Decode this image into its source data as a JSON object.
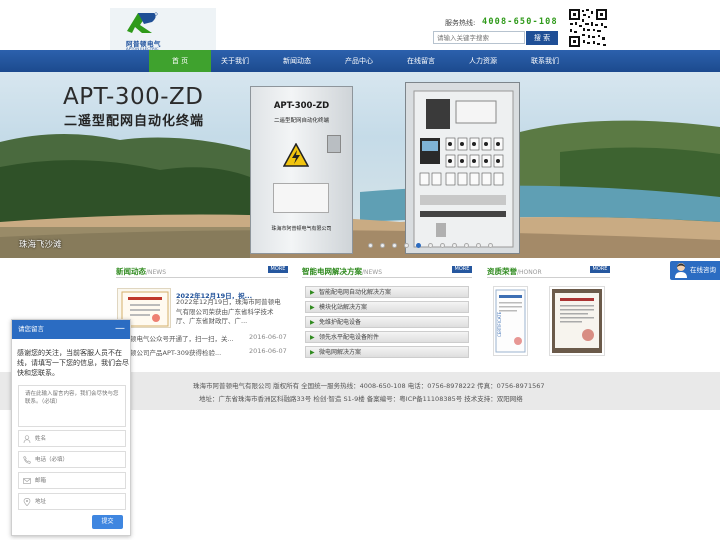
{
  "brand": {
    "name_cn": "阿普顿电气",
    "name_en": "APTON ELECTRIC",
    "accent_blue": "#1f4f96",
    "accent_green": "#3fa22e"
  },
  "header": {
    "hotline_label": "服务热线:",
    "hotline_number": "4008-650-108",
    "search_placeholder": "请输入关键字搜索",
    "search_button": "搜 索"
  },
  "nav": {
    "items": [
      {
        "label": "首 页",
        "active": true
      },
      {
        "label": "关于我们",
        "active": false
      },
      {
        "label": "新闻动态",
        "active": false
      },
      {
        "label": "产品中心",
        "active": false
      },
      {
        "label": "在线留言",
        "active": false
      },
      {
        "label": "人力资源",
        "active": false
      },
      {
        "label": "联系我们",
        "active": false
      }
    ]
  },
  "banner": {
    "title": "APT-300-ZD",
    "subtitle": "二遥型配网自动化终端",
    "cabinet_title": "APT-300-ZD",
    "cabinet_subtitle": "二遥型配网自动化终端",
    "cabinet_maker": "珠海市阿普顿电气有限公司",
    "caption": "珠海飞沙滩",
    "slide_count": 11,
    "active_slide": 4
  },
  "news": {
    "heading": "新闻动态",
    "heading_en": "NEWS",
    "more": "MORE",
    "headline": "2022年12月19日，祝...",
    "summary": "2022年12月19日，珠海市阿普顿电气有限公司荣获由广东省科学技术厅、广东省财政厅、广...",
    "items": [
      {
        "title": "阿普顿电气公众号开通了，扫一扫，关...",
        "date": "2016-06-07"
      },
      {
        "title": "阿普顿公司产品APT-309获得检验...",
        "date": "2016-06-07"
      }
    ]
  },
  "solutions": {
    "heading": "智能电网解决方案",
    "heading_en": "NEWS",
    "more": "MORE",
    "items": [
      "智能配电网自动化解决方案",
      "模块化站解决方案",
      "免维护配电设备",
      "领先水平配电设备附件",
      "微电网解决方案"
    ]
  },
  "honors": {
    "heading": "资质荣誉",
    "heading_en": "HONOR",
    "more": "MORE"
  },
  "side_consult": "在线咨询",
  "footer": {
    "line1": "珠海市阿普顿电气有限公司 版权所有 全国统一服务热线：4008-650-108 电话：0756-8978222 传真：0756-8971567",
    "line2": "地址：广东省珠海市香洲区科融路33号 检创·智造 S1-9楼 备案编号：粤ICP备11108385号 技术支持：双阳网络"
  },
  "chat": {
    "title": "请您留言",
    "minimize": "—",
    "message": "感谢您的关注，当前客服人员不在线，请填写一下您的信息，我们会尽快和您联系。",
    "textarea_placeholder": "请在此输入留言内容，我们会尽快与您联系。（必填）",
    "fields": [
      {
        "icon": "user-icon",
        "placeholder": "姓名"
      },
      {
        "icon": "phone-icon",
        "placeholder": "电话（必填）"
      },
      {
        "icon": "mail-icon",
        "placeholder": "邮箱"
      },
      {
        "icon": "location-icon",
        "placeholder": "地址"
      }
    ],
    "submit": "提交"
  }
}
